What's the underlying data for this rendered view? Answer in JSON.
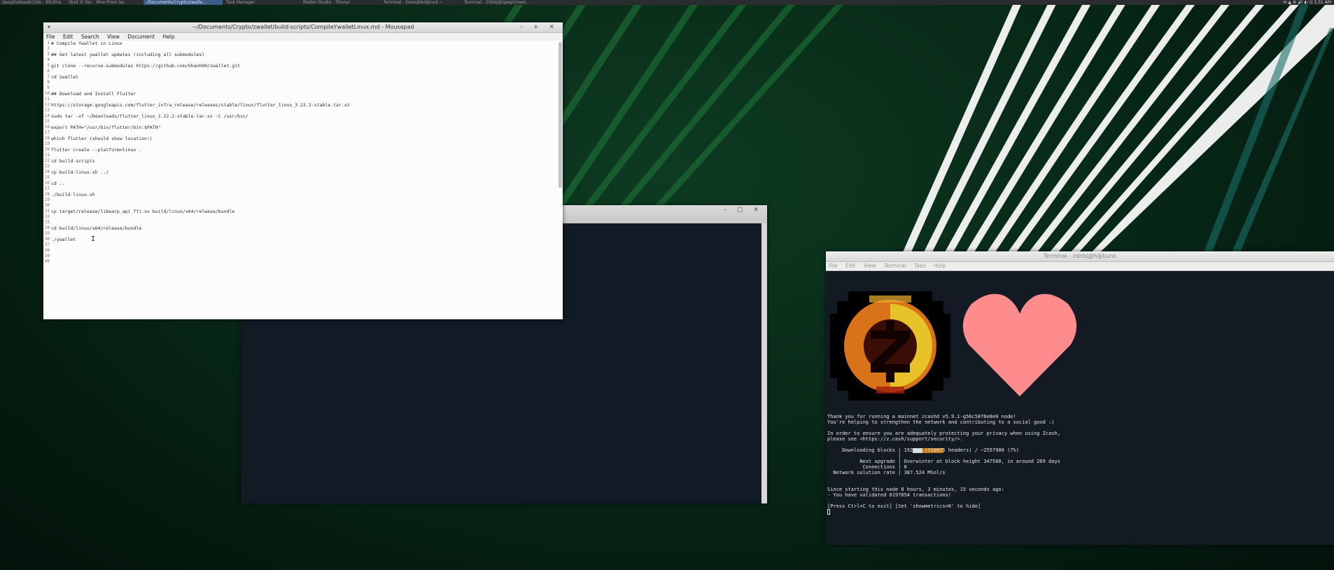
{
  "taskbar": {
    "tasks": [
      "zpeyJ0ublaa9r1tdo - Ellcitrie",
      "Stad 3/ 3sc - Mne Prom Se..",
      "-/Documents/Crypto/zwalle...",
      "Task Manager",
      "Roster Studio - Thunar",
      "Terminal - Gazo@bd@nxd ~",
      "Terminal - Zdobj@zpeg(zzwel..."
    ],
    "tray_text": "✉ ▲ ⚙ 🔊 ◐ ⏻ 1:31 AM"
  },
  "mousepad": {
    "title": "~/Documents/Crypto/zwallet/build-scripts/CompileYwalletLinux.md - Mousepad",
    "menu": [
      "File",
      "Edit",
      "Search",
      "View",
      "Document",
      "Help"
    ],
    "line_numbers": [
      "1",
      "2",
      "3",
      "4",
      "5",
      "6",
      "7",
      "8",
      "9",
      "10",
      "11",
      "12",
      "13",
      "14",
      "15",
      "16",
      "17",
      "18",
      "19",
      "20",
      "21",
      "22",
      "23",
      "24",
      "25",
      "26",
      "27",
      "28",
      "29",
      "30",
      "31",
      "32",
      "33",
      "34",
      "35",
      "36",
      "37",
      "38",
      "39",
      "40"
    ],
    "lines": [
      "# Compile Ywallet in Linux",
      "",
      "## Get latest ywallet updates (including all submodules)",
      "",
      "git clone --recurse-submodules https://github.com/hhanh00/zwallet.git",
      "",
      "cd zwallet",
      "",
      "",
      "## Download and Install Flutter",
      "",
      "https://storage.googleapis.com/flutter_infra_release/releases/stable/linux/flutter_linux_3.22.2-stable.tar.xz",
      "",
      "sudo tar -xf ~/Downloads/flutter_linux_3.22.2-stable.tar.xz -C /usr/bin/",
      "",
      "export PATH=\"/usr/bin/flutter/bin:$PATH\"",
      "",
      "which flutter (should show location!)",
      "",
      "flutter create --platform=linux .",
      "",
      "cd build-scripts",
      "",
      "cp build-linux.sh ../",
      "",
      "cd ..",
      "",
      "./build-linux.sh",
      "",
      "",
      "cp target/release/libwarp_api_ffi.so build/linux/x64/release/bundle",
      "",
      "",
      "cd build/linux/x64/release/bundle",
      "",
      "./ywallet",
      "",
      "",
      "",
      ""
    ]
  },
  "terminal": {
    "title": "Terminal - zdobj@h@bunx",
    "menu": [
      "File",
      "Edit",
      "View",
      "Terminal",
      "Tabs",
      "Help"
    ],
    "lines": [
      "Thank you for running a mainnet zcashd v5.9.1-g56c58f6e8e0 node!",
      "You're helping to strengthen the network and contributing to a social good :)",
      "",
      "In order to ensure you are adequately protecting your privacy when using Zcash,",
      "please see <https://z.cash/support/security/>.",
      "",
      "     Downloading blocks | 192340 (710975 headers) / ~2557900 (7%)",
      "                        |",
      "           Next upgrade | Overwinter at block height 347500, in around 269 days",
      "            Connections | 8",
      "  Network solution rate | 387.524 MSol/s",
      "",
      "",
      "Since starting this node 8 hours, 3 minutes, 15 seconds ago:",
      "- You have validated 6197054 transactions!",
      "",
      "[Press Ctrl+C to exit] [Set 'showmetrics=0' to hide]"
    ],
    "sync_progress": 0.07
  },
  "colors": {
    "zcash_gold": "#e8c229",
    "zcash_orange": "#d8731a",
    "heart_pink": "#ff8c8c",
    "progress_orange": "#c97b1a"
  }
}
